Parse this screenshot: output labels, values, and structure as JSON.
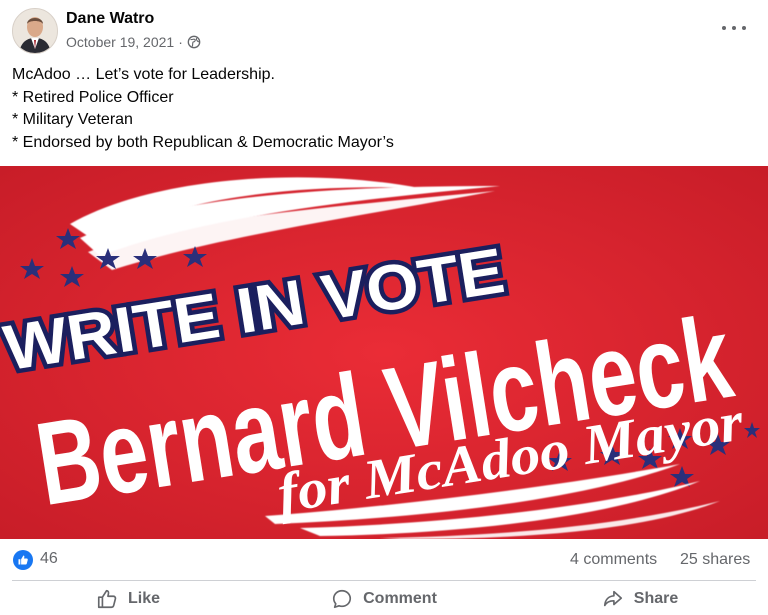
{
  "post": {
    "author": "Dane Watro",
    "date": "October 19, 2021",
    "date_separator": "·",
    "privacy_icon": "globe-icon",
    "more_icon": "more-options-icon",
    "text_lines": [
      "McAdoo … Let’s vote for Leadership.",
      "* Retired Police Officer",
      "* Military Veteran",
      "* Endorsed by both Republican & Democratic Mayor’s"
    ]
  },
  "image": {
    "line1": "WRITE IN VOTE",
    "line2": "Bernard Vilcheck",
    "line3": "for McAdoo Mayor",
    "colors": {
      "background": "#e02430",
      "text": "#ffffff",
      "outline": "#1b1f5e",
      "stars": "#2a2f7a"
    }
  },
  "stats": {
    "reactions": "46",
    "comments": "4 comments",
    "shares": "25 shares"
  },
  "actions": {
    "like": "Like",
    "comment": "Comment",
    "share": "Share"
  },
  "colors": {
    "accent": "#1877f2",
    "secondary_text": "#65676b",
    "divider": "#ced0d4"
  }
}
